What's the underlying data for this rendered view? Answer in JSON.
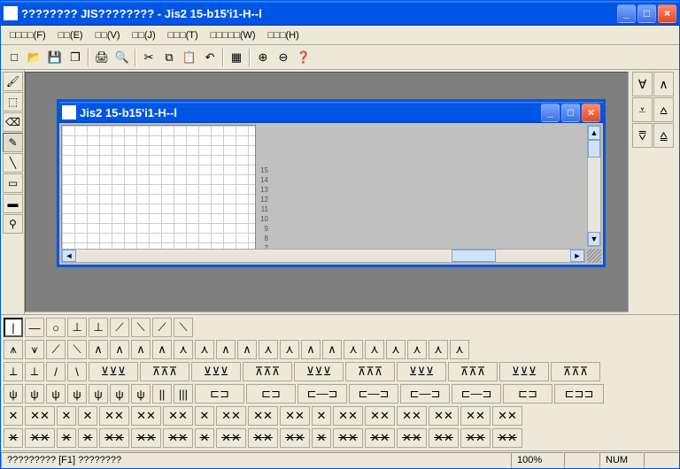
{
  "window": {
    "title": "???????? JIS???????? - Jis2 15-b15'i1-H--l",
    "min_icon": "_",
    "max_icon": "□",
    "close_icon": "×"
  },
  "menubar": [
    "□□□□(F)",
    "□□(E)",
    "□□(V)",
    "□□(J)",
    "□□□(T)",
    "□□□□□(W)",
    "□□□(H)"
  ],
  "toolbar": [
    {
      "name": "new-icon",
      "glyph": "□"
    },
    {
      "name": "open-icon",
      "glyph": "📂"
    },
    {
      "name": "save-icon",
      "glyph": "💾"
    },
    {
      "name": "save-all-icon",
      "glyph": "❐"
    },
    {
      "sep": true
    },
    {
      "name": "print-icon",
      "glyph": "🖨"
    },
    {
      "name": "print-preview-icon",
      "glyph": "🔍"
    },
    {
      "sep": true
    },
    {
      "name": "cut-icon",
      "glyph": "✂"
    },
    {
      "name": "copy-icon",
      "glyph": "⧉"
    },
    {
      "name": "paste-icon",
      "glyph": "📋"
    },
    {
      "name": "undo-icon",
      "glyph": "↶"
    },
    {
      "sep": true
    },
    {
      "name": "grid-icon",
      "glyph": "▦"
    },
    {
      "sep": true
    },
    {
      "name": "zoom-in-icon",
      "glyph": "⊕"
    },
    {
      "name": "zoom-out-icon",
      "glyph": "⊖"
    },
    {
      "name": "help-icon",
      "glyph": "❓"
    }
  ],
  "left_tools": [
    {
      "name": "brush-icon",
      "glyph": "🖌"
    },
    {
      "name": "marquee-icon",
      "glyph": "⬚"
    },
    {
      "name": "eraser-icon",
      "glyph": "⌫"
    },
    {
      "name": "pencil-icon",
      "glyph": "✎",
      "pressed": true
    },
    {
      "name": "line-icon",
      "glyph": "╲"
    },
    {
      "name": "rect-icon",
      "glyph": "▭"
    },
    {
      "name": "fillrect-icon",
      "glyph": "▬"
    },
    {
      "name": "eyedrop-icon",
      "glyph": "⚲"
    }
  ],
  "right_tools": [
    {
      "name": "stitch-v-icon",
      "glyph": "∀"
    },
    {
      "name": "stitch-a-icon",
      "glyph": "∧"
    },
    {
      "name": "stitch-vbar-icon",
      "glyph": "⩡"
    },
    {
      "name": "stitch-abar-icon",
      "glyph": "⩟"
    },
    {
      "name": "stitch-vd-icon",
      "glyph": "⩢"
    },
    {
      "name": "stitch-ad-icon",
      "glyph": "⩠"
    }
  ],
  "child": {
    "title": "Jis2 15-b15'i1-H--l",
    "ruler": [
      "7",
      "8",
      "9",
      "10",
      "11",
      "12",
      "13",
      "14",
      "15"
    ]
  },
  "palette": {
    "row1": [
      "|",
      "—",
      "○",
      "⊥",
      "⊥",
      "⟋",
      "⟍",
      "⟋",
      "⟍"
    ],
    "row2": [
      "⩚",
      "⩛",
      "⟋",
      "⟍",
      "∧",
      "∧",
      "∧",
      "∧",
      "⋏",
      "⋏",
      "∧",
      "∧",
      "⋏",
      "⋏",
      "∧",
      "∧",
      "⋏",
      "⋏",
      "⋏",
      "⋏",
      "⋏",
      "⋏"
    ],
    "row3_a": [
      "⟂",
      "⟂",
      "/",
      "\\"
    ],
    "row3_b": [
      "⊻⊻⊻",
      "⊼⊼⊼",
      "⊻⊻⊻",
      "⊼⊼⊼",
      "⊻⊻⊻",
      "⊼⊼⊼",
      "⊻⊻⊻",
      "⊼⊼⊼",
      "⊻⊻⊻",
      "⊼⊼⊼"
    ],
    "row4_a": [
      "ψ",
      "ψ",
      "ψ",
      "ψ",
      "ψ",
      "ψ",
      "ψ",
      "||",
      "|||"
    ],
    "row4_b": [
      "⊏⊐",
      "⊏⊐",
      "⊏—⊐",
      "⊏—⊐",
      "⊏—⊐",
      "⊏—⊐",
      "⊏⊐",
      "⊏⊐⊐"
    ],
    "row5": [
      "✕",
      "✕✕",
      "✕",
      "✕",
      "✕✕",
      "✕✕",
      "✕✕",
      "✕",
      "✕✕",
      "✕✕",
      "✕✕",
      "✕",
      "✕✕",
      "✕✕",
      "✕✕",
      "✕✕",
      "✕✕",
      "✕✕"
    ],
    "row6": [
      "✕",
      "✕✕",
      "✕",
      "✕",
      "✕✕",
      "✕✕",
      "✕✕",
      "✕",
      "✕✕",
      "✕✕",
      "✕✕",
      "✕",
      "✕✕",
      "✕✕",
      "✕✕",
      "✕✕",
      "✕✕",
      "✕✕"
    ]
  },
  "status": {
    "help": "????????? [F1] ????????",
    "zoom": "100%",
    "num": "NUM"
  }
}
